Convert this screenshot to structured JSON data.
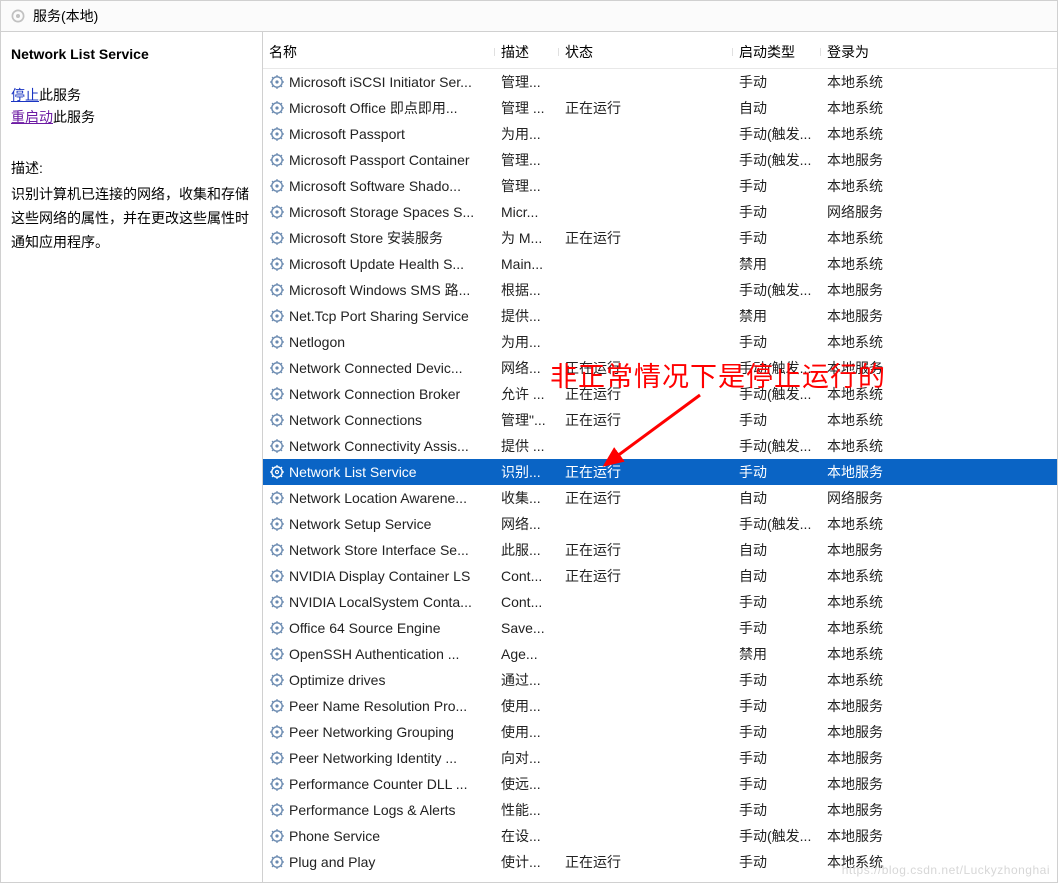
{
  "titlebar": {
    "label": "服务(本地)"
  },
  "sidebar": {
    "heading": "Network List Service",
    "stop_link": "停止",
    "stop_suffix": "此服务",
    "restart_link": "重启动",
    "restart_suffix": "此服务",
    "desc_label": "描述:",
    "desc_text": "识别计算机已连接的网络，收集和存储这些网络的属性，并在更改这些属性时通知应用程序。"
  },
  "columns": {
    "name": "名称",
    "desc": "描述",
    "status": "状态",
    "start": "启动类型",
    "logon": "登录为"
  },
  "services": [
    {
      "name": "Microsoft iSCSI Initiator Ser...",
      "desc": "管理...",
      "status": "",
      "start": "手动",
      "logon": "本地系统"
    },
    {
      "name": "Microsoft Office 即点即用...",
      "desc": "管理 ...",
      "status": "正在运行",
      "start": "自动",
      "logon": "本地系统"
    },
    {
      "name": "Microsoft Passport",
      "desc": "为用...",
      "status": "",
      "start": "手动(触发...",
      "logon": "本地系统"
    },
    {
      "name": "Microsoft Passport Container",
      "desc": "管理...",
      "status": "",
      "start": "手动(触发...",
      "logon": "本地服务"
    },
    {
      "name": "Microsoft Software Shado...",
      "desc": "管理...",
      "status": "",
      "start": "手动",
      "logon": "本地系统"
    },
    {
      "name": "Microsoft Storage Spaces S...",
      "desc": "Micr...",
      "status": "",
      "start": "手动",
      "logon": "网络服务"
    },
    {
      "name": "Microsoft Store 安装服务",
      "desc": "为 M...",
      "status": "正在运行",
      "start": "手动",
      "logon": "本地系统"
    },
    {
      "name": "Microsoft Update Health S...",
      "desc": "Main...",
      "status": "",
      "start": "禁用",
      "logon": "本地系统"
    },
    {
      "name": "Microsoft Windows SMS 路...",
      "desc": "根据...",
      "status": "",
      "start": "手动(触发...",
      "logon": "本地服务"
    },
    {
      "name": "Net.Tcp Port Sharing Service",
      "desc": "提供...",
      "status": "",
      "start": "禁用",
      "logon": "本地服务"
    },
    {
      "name": "Netlogon",
      "desc": "为用...",
      "status": "",
      "start": "手动",
      "logon": "本地系统"
    },
    {
      "name": "Network Connected Devic...",
      "desc": "网络...",
      "status": "正在运行",
      "start": "手动(触发...",
      "logon": "本地服务"
    },
    {
      "name": "Network Connection Broker",
      "desc": "允许 ...",
      "status": "正在运行",
      "start": "手动(触发...",
      "logon": "本地系统"
    },
    {
      "name": "Network Connections",
      "desc": "管理\"...",
      "status": "正在运行",
      "start": "手动",
      "logon": "本地系统"
    },
    {
      "name": "Network Connectivity Assis...",
      "desc": "提供 ...",
      "status": "",
      "start": "手动(触发...",
      "logon": "本地系统"
    },
    {
      "name": "Network List Service",
      "desc": "识别...",
      "status": "正在运行",
      "start": "手动",
      "logon": "本地服务",
      "selected": true
    },
    {
      "name": "Network Location Awarene...",
      "desc": "收集...",
      "status": "正在运行",
      "start": "自动",
      "logon": "网络服务"
    },
    {
      "name": "Network Setup Service",
      "desc": "网络...",
      "status": "",
      "start": "手动(触发...",
      "logon": "本地系统"
    },
    {
      "name": "Network Store Interface Se...",
      "desc": "此服...",
      "status": "正在运行",
      "start": "自动",
      "logon": "本地服务"
    },
    {
      "name": "NVIDIA Display Container LS",
      "desc": "Cont...",
      "status": "正在运行",
      "start": "自动",
      "logon": "本地系统"
    },
    {
      "name": "NVIDIA LocalSystem Conta...",
      "desc": "Cont...",
      "status": "",
      "start": "手动",
      "logon": "本地系统"
    },
    {
      "name": "Office 64 Source Engine",
      "desc": "Save...",
      "status": "",
      "start": "手动",
      "logon": "本地系统"
    },
    {
      "name": "OpenSSH Authentication ...",
      "desc": "Age...",
      "status": "",
      "start": "禁用",
      "logon": "本地系统"
    },
    {
      "name": "Optimize drives",
      "desc": "通过...",
      "status": "",
      "start": "手动",
      "logon": "本地系统"
    },
    {
      "name": "Peer Name Resolution Pro...",
      "desc": "使用...",
      "status": "",
      "start": "手动",
      "logon": "本地服务"
    },
    {
      "name": "Peer Networking Grouping",
      "desc": "使用...",
      "status": "",
      "start": "手动",
      "logon": "本地服务"
    },
    {
      "name": "Peer Networking Identity ...",
      "desc": "向对...",
      "status": "",
      "start": "手动",
      "logon": "本地服务"
    },
    {
      "name": "Performance Counter DLL ...",
      "desc": "使远...",
      "status": "",
      "start": "手动",
      "logon": "本地服务"
    },
    {
      "name": "Performance Logs & Alerts",
      "desc": "性能...",
      "status": "",
      "start": "手动",
      "logon": "本地服务"
    },
    {
      "name": "Phone Service",
      "desc": "在设...",
      "status": "",
      "start": "手动(触发...",
      "logon": "本地服务"
    },
    {
      "name": "Plug and Play",
      "desc": "使计...",
      "status": "正在运行",
      "start": "手动",
      "logon": "本地系统"
    }
  ],
  "annotation": {
    "text": "非正常情况下是停止运行的"
  },
  "watermark": "https://blog.csdn.net/Luckyzhonghai"
}
